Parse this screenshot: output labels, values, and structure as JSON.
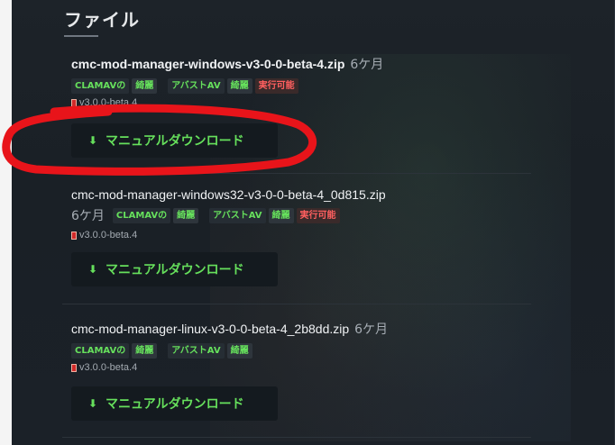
{
  "section": {
    "title": "ファイル"
  },
  "files": [
    {
      "name": "cmc-mod-manager-windows-v3-0-0-beta-4.zip",
      "age": "6ケ月",
      "badges": {
        "clamav_label": "CLAMAVの",
        "clamav_status": "綺麗",
        "avast_label": "アバストAV",
        "avast_status": "綺麗",
        "exec": "実行可能"
      },
      "version": "v3.0.0-beta.4",
      "download_label": "マニュアルダウンロード"
    },
    {
      "name": "cmc-mod-manager-windows32-v3-0-0-beta-4_0d815.zip",
      "age": "6ケ月",
      "badges": {
        "clamav_label": "CLAMAVの",
        "clamav_status": "綺麗",
        "avast_label": "アバストAV",
        "avast_status": "綺麗",
        "exec": "実行可能"
      },
      "version": "v3.0.0-beta.4",
      "download_label": "マニュアルダウンロード"
    },
    {
      "name": "cmc-mod-manager-linux-v3-0-0-beta-4_2b8dd.zip",
      "age": "6ケ月",
      "badges": {
        "clamav_label": "CLAMAVの",
        "clamav_status": "綺麗",
        "avast_label": "アバストAV",
        "avast_status": "綺麗"
      },
      "version": "v3.0.0-beta.4",
      "download_label": "マニュアルダウンロード"
    }
  ],
  "colors": {
    "accent_green": "#66e05c",
    "warn_red": "#ff5f5f",
    "annotation_red": "#e8141a"
  },
  "icons": {
    "download": "arrow-down-icon",
    "version": "book-icon"
  }
}
